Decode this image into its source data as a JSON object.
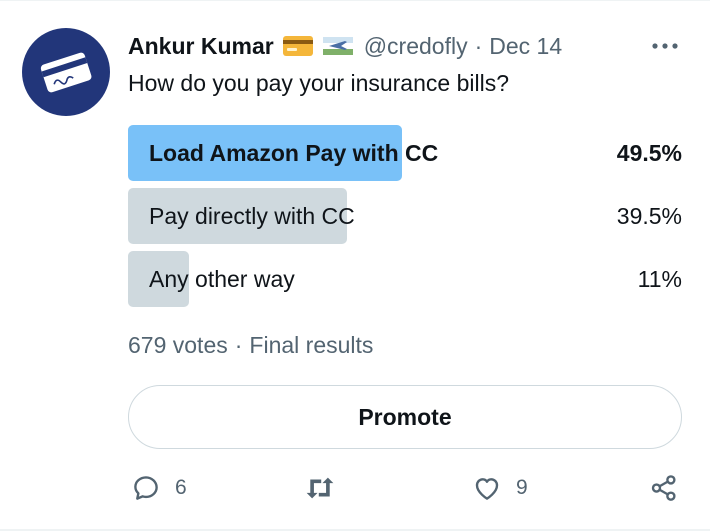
{
  "tweet": {
    "author_name": "Ankur Kumar",
    "handle": "@credofly",
    "separator": "·",
    "date": "Dec 14",
    "text": "How do you pay your insurance bills?",
    "author_emojis": [
      "credit-card-emoji",
      "airplane-flag-emoji"
    ]
  },
  "poll": {
    "options": [
      {
        "label": "Load Amazon Pay with CC",
        "percent": "49.5%",
        "share": 0.495,
        "winner": true
      },
      {
        "label": "Pay directly with CC",
        "percent": "39.5%",
        "share": 0.395,
        "winner": false
      },
      {
        "label": "Any other way",
        "percent": "11%",
        "share": 0.11,
        "winner": false
      }
    ],
    "votes": "679 votes",
    "status": "Final results",
    "separator": "·"
  },
  "promote_label": "Promote",
  "actions": {
    "reply_count": "6",
    "like_count": "9"
  },
  "colors": {
    "winner_bar": "#79c1f8",
    "other_bar": "#cfd9de",
    "avatar_bg": "#22367a",
    "secondary_text": "#536471"
  }
}
